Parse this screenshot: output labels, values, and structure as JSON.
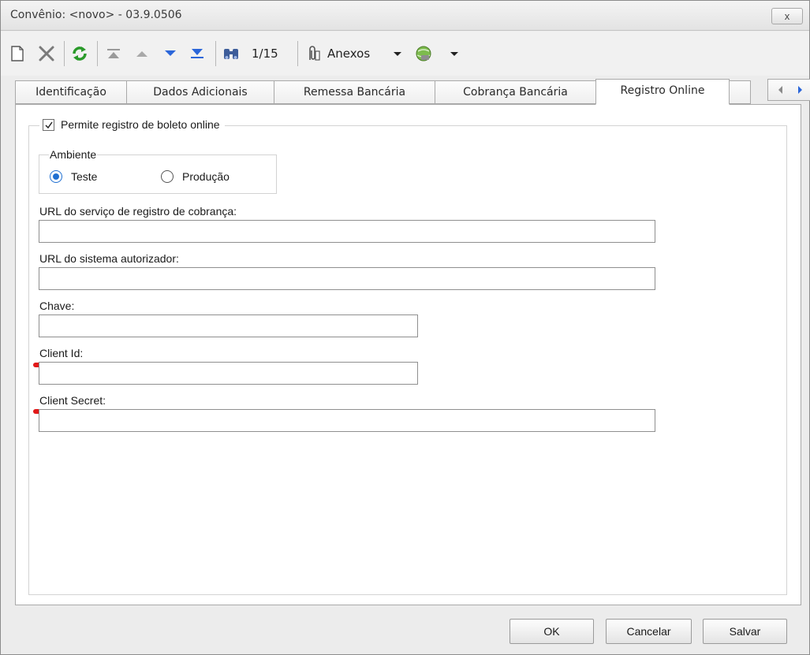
{
  "window": {
    "title": "Convênio: <novo> - 03.9.0506",
    "close_label": "x"
  },
  "toolbar": {
    "record_position": "1/15",
    "attachments_label": "Anexos",
    "icons": [
      "new-document-icon",
      "delete-icon",
      "refresh-icon",
      "first-record-icon",
      "previous-record-icon",
      "next-record-icon",
      "last-record-icon",
      "find-icon",
      "paperclip-icon",
      "globe-icon"
    ]
  },
  "tabs": [
    {
      "label": "Identificação"
    },
    {
      "label": "Dados Adicionais"
    },
    {
      "label": "Remessa Bancária"
    },
    {
      "label": "Cobrança Bancária"
    },
    {
      "label": "Registro Online",
      "active": true
    }
  ],
  "registro": {
    "enable_label": "Permite registro de boleto online",
    "enable_checked": true,
    "ambiente": {
      "legend": "Ambiente",
      "options": [
        {
          "label": "Teste",
          "selected": true
        },
        {
          "label": "Produção",
          "selected": false
        }
      ]
    },
    "fields": {
      "url_servico": {
        "label": "URL do serviço de registro de cobrança:",
        "value": ""
      },
      "url_autorizador": {
        "label": "URL do sistema autorizador:",
        "value": ""
      },
      "chave": {
        "label": "Chave:",
        "value": ""
      },
      "client_id": {
        "label": "Client Id:",
        "value": ""
      },
      "client_secret": {
        "label": "Client Secret:",
        "value": ""
      }
    }
  },
  "footer": {
    "ok_label": "OK",
    "cancel_label": "Cancelar",
    "save_label": "Salvar"
  },
  "colors": {
    "highlight": "#e11818",
    "radio_accent": "#1f6fd1"
  }
}
